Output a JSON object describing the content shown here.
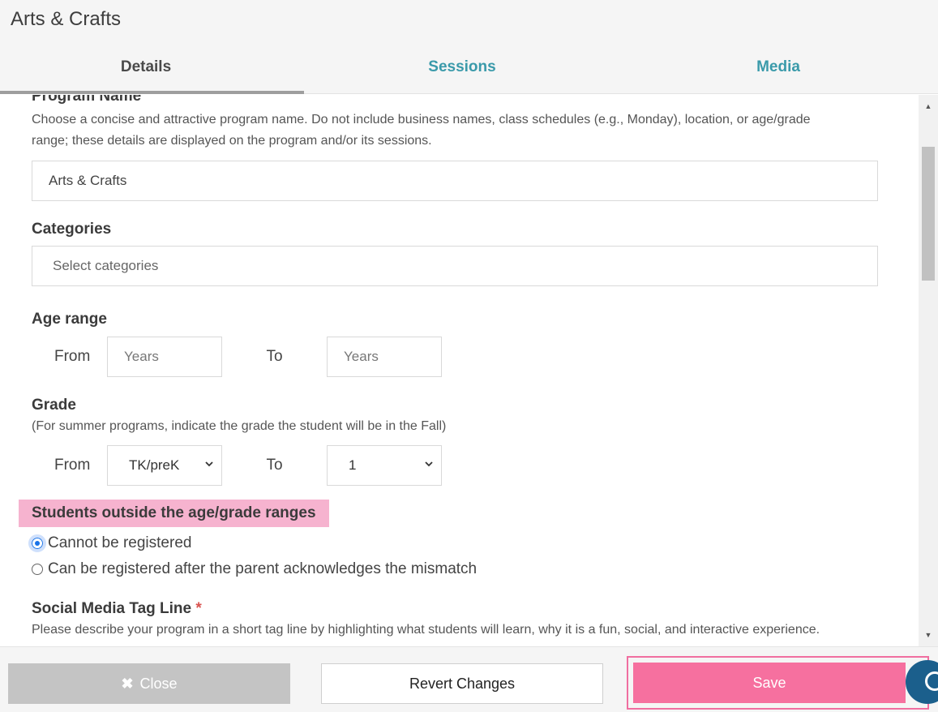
{
  "header": {
    "title": "Arts & Crafts",
    "tabs": [
      {
        "label": "Details"
      },
      {
        "label": "Sessions"
      },
      {
        "label": "Media"
      }
    ]
  },
  "form": {
    "program_name": {
      "label": "Program Name",
      "help": "Choose a concise and attractive program name. Do not include business names, class schedules (e.g., Monday), location, or age/grade range; these details are displayed on the program and/or its sessions.",
      "value": "Arts & Crafts"
    },
    "categories": {
      "label": "Categories",
      "placeholder": "Select categories"
    },
    "age_range": {
      "label": "Age range",
      "from_label": "From",
      "to_label": "To",
      "from_placeholder": "Years",
      "to_placeholder": "Years"
    },
    "grade": {
      "label": "Grade",
      "help": "(For summer programs, indicate the grade the student will be in the Fall)",
      "from_label": "From",
      "to_label": "To",
      "from_value": "TK/preK",
      "to_value": "1"
    },
    "outside_range": {
      "label": "Students outside the age/grade ranges",
      "options": [
        {
          "label": "Cannot be registered",
          "checked": true
        },
        {
          "label": "Can be registered after the parent acknowledges the mismatch",
          "checked": false
        }
      ]
    },
    "tag_line": {
      "label": "Social Media Tag Line",
      "required_mark": "*",
      "help": "Please describe your program in a short tag line by highlighting what students will learn, why it is a fun, social, and interactive experience."
    }
  },
  "footer": {
    "close_icon": "✖",
    "close_label": "Close",
    "revert_label": "Revert Changes",
    "save_label": "Save"
  },
  "colors": {
    "accent_teal": "#3a9aaa",
    "save_pink": "#f6709f",
    "highlight_pink": "#f6b3cf",
    "chat_blue": "#1b5f8c"
  }
}
